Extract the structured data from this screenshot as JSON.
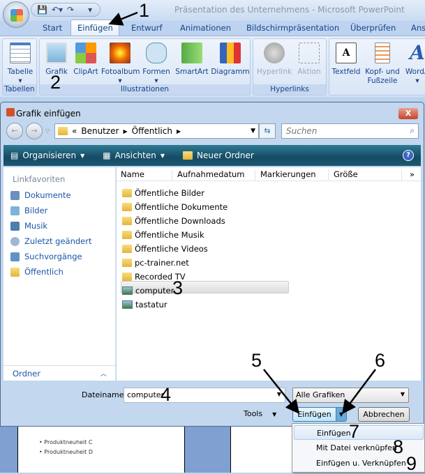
{
  "app": {
    "title": "Präsentation des Unternehmens - Microsoft PowerPoint"
  },
  "tabs": [
    "Start",
    "Einfügen",
    "Entwurf",
    "Animationen",
    "Bildschirmpräsentation",
    "Überprüfen",
    "Ans"
  ],
  "active_tab": "Einfügen",
  "ribbon": {
    "groups": [
      {
        "label": "Tabellen"
      },
      {
        "label": "Illustrationen"
      },
      {
        "label": "Hyperlinks"
      }
    ],
    "buttons": [
      "Tabelle",
      "Grafik",
      "ClipArt",
      "Fotoalbum",
      "Formen",
      "SmartArt",
      "Diagramm",
      "Hyperlink",
      "Aktion",
      "Textfeld",
      "Kopf- und",
      "Fußzeile",
      "WordA"
    ]
  },
  "dialog": {
    "title": "Grafik einfügen",
    "close": "X",
    "breadcrumb": [
      "«",
      "Benutzer",
      "Öffentlich"
    ],
    "search_placeholder": "Suchen",
    "toolbar": {
      "organize": "Organisieren",
      "views": "Ansichten",
      "new_folder": "Neuer Ordner",
      "help": "?"
    },
    "favorites_header": "Linkfavoriten",
    "favorites": [
      "Dokumente",
      "Bilder",
      "Musik",
      "Zuletzt geändert",
      "Suchvorgänge",
      "Öffentlich"
    ],
    "folders_label": "Ordner",
    "columns": [
      "Name",
      "Aufnahmedatum",
      "Markierungen",
      "Größe",
      "»"
    ],
    "files": [
      {
        "name": "Öffentliche Bilder",
        "type": "folder"
      },
      {
        "name": "Öffentliche Dokumente",
        "type": "folder"
      },
      {
        "name": "Öffentliche Downloads",
        "type": "folder"
      },
      {
        "name": "Öffentliche Musik",
        "type": "folder"
      },
      {
        "name": "Öffentliche Videos",
        "type": "folder"
      },
      {
        "name": "pc-trainer.net",
        "type": "folder"
      },
      {
        "name": "Recorded TV",
        "type": "folder"
      },
      {
        "name": "computer",
        "type": "image",
        "selected": true
      },
      {
        "name": "tastatur",
        "type": "image"
      }
    ],
    "filename_label": "Dateiname:",
    "filename_value": "computer",
    "filetype": "Alle Grafiken",
    "tools": "Tools",
    "insert": "Einfügen",
    "cancel": "Abbrechen"
  },
  "insert_menu": [
    "Einfügen",
    "Mit Datei verknüpfen",
    "Einfügen u. Verknüpfen"
  ],
  "slide_bullets": [
    "Produktneuheit C",
    "Produktneuheit D"
  ],
  "annotations": [
    "1",
    "2",
    "3",
    "4",
    "5",
    "6",
    "7",
    "8",
    "9"
  ]
}
